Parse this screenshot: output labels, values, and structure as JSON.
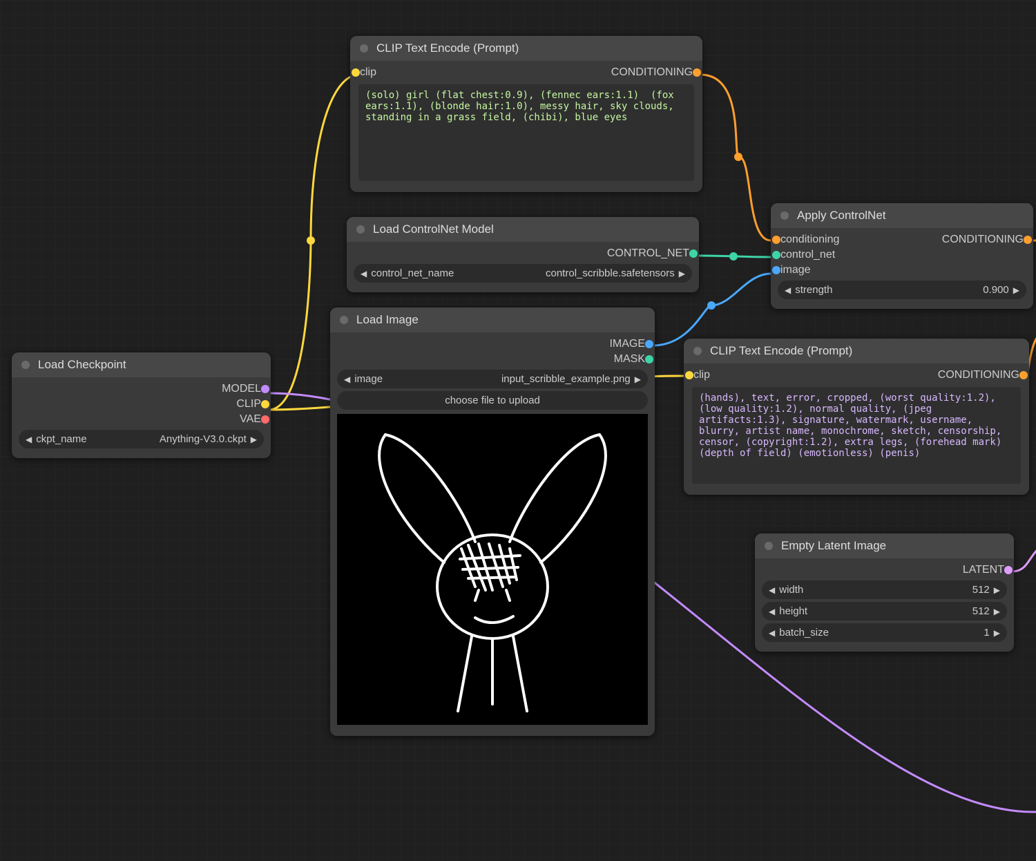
{
  "nodes": {
    "load_checkpoint": {
      "title": "Load Checkpoint",
      "outputs": {
        "model": "MODEL",
        "clip": "CLIP",
        "vae": "VAE"
      },
      "ckpt_name_label": "ckpt_name",
      "ckpt_name_value": "Anything-V3.0.ckpt"
    },
    "clip_encode_pos": {
      "title": "CLIP Text Encode (Prompt)",
      "input_clip": "clip",
      "output_cond": "CONDITIONING",
      "text": "(solo) girl (flat chest:0.9), (fennec ears:1.1)  (fox ears:1.1), (blonde hair:1.0), messy hair, sky clouds, standing in a grass field, (chibi), blue eyes"
    },
    "load_controlnet": {
      "title": "Load ControlNet Model",
      "output_cn": "CONTROL_NET",
      "cn_name_label": "control_net_name",
      "cn_name_value": "control_scribble.safetensors"
    },
    "load_image": {
      "title": "Load Image",
      "output_image": "IMAGE",
      "output_mask": "MASK",
      "image_label": "image",
      "image_value": "input_scribble_example.png",
      "upload_btn": "choose file to upload"
    },
    "clip_encode_neg": {
      "title": "CLIP Text Encode (Prompt)",
      "input_clip": "clip",
      "output_cond": "CONDITIONING",
      "text": "(hands), text, error, cropped, (worst quality:1.2), (low quality:1.2), normal quality, (jpeg artifacts:1.3), signature, watermark, username, blurry, artist name, monochrome, sketch, censorship, censor, (copyright:1.2), extra legs, (forehead mark) (depth of field) (emotionless) (penis)"
    },
    "apply_controlnet": {
      "title": "Apply ControlNet",
      "in_cond": "conditioning",
      "in_cn": "control_net",
      "in_image": "image",
      "out_cond": "CONDITIONING",
      "strength_label": "strength",
      "strength_value": "0.900"
    },
    "empty_latent": {
      "title": "Empty Latent Image",
      "out_latent": "LATENT",
      "width_label": "width",
      "width_value": "512",
      "height_label": "height",
      "height_value": "512",
      "batch_label": "batch_size",
      "batch_value": "1"
    }
  },
  "colors": {
    "model": "#c38bff",
    "clip": "#ffd83d",
    "vae": "#ff6a6a",
    "conditioning": "#ff9f2e",
    "control_net": "#3dd4a7",
    "image": "#4aa8ff",
    "mask": "#3dd4a7",
    "latent": "#e09cff"
  }
}
